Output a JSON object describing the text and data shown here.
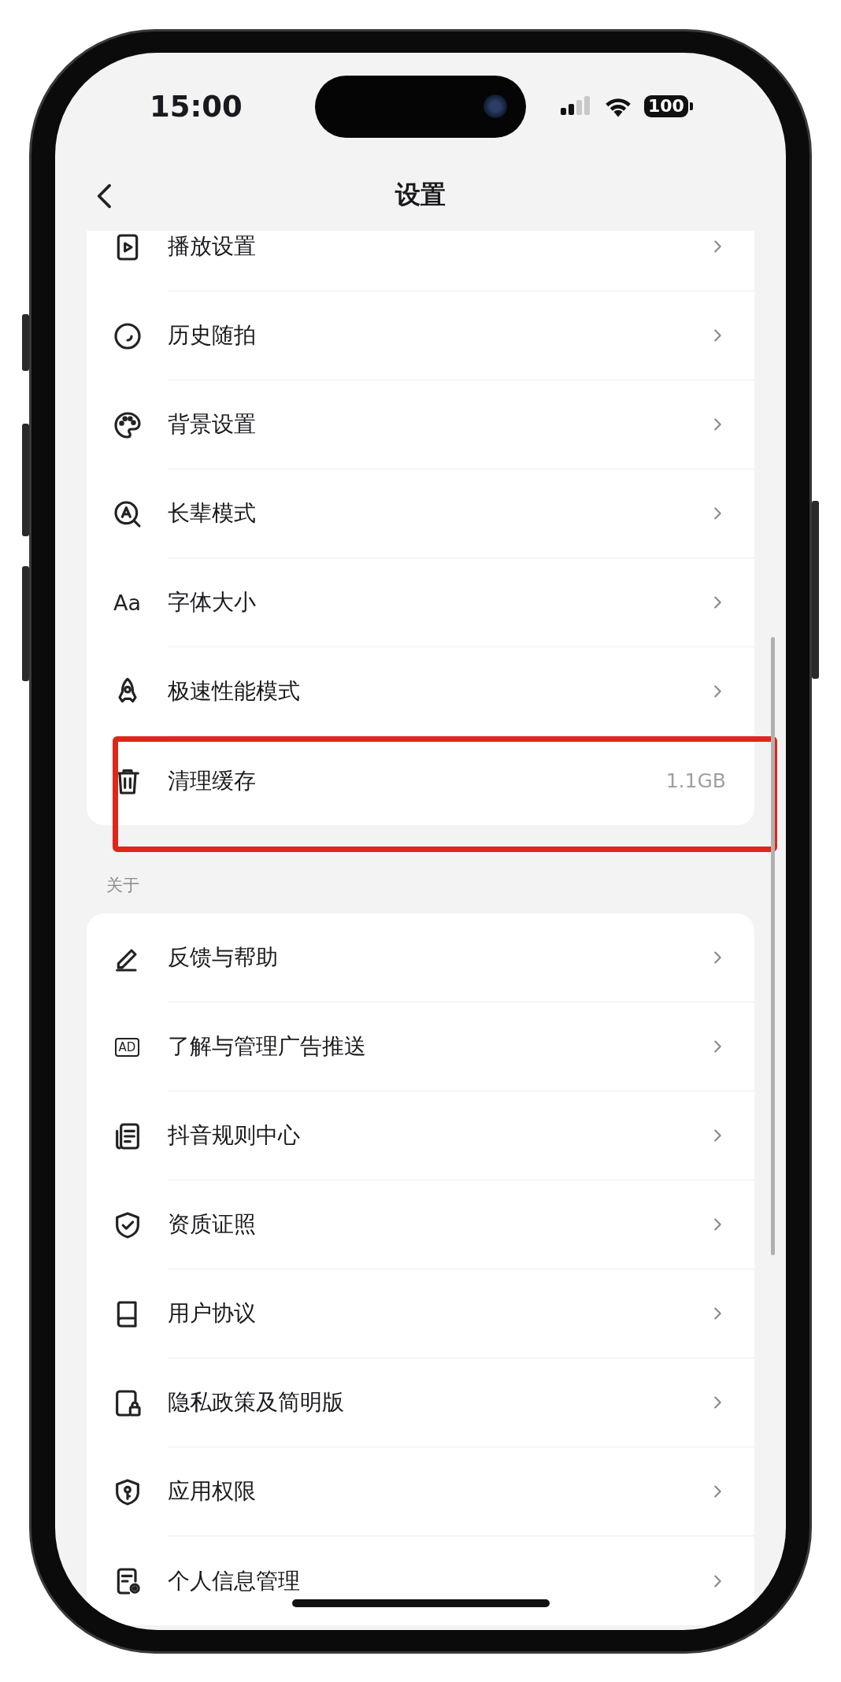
{
  "status_bar": {
    "time": "15:00",
    "battery": "100"
  },
  "nav": {
    "title": "设置"
  },
  "sections": [
    {
      "items": [
        {
          "label": "播放设置",
          "highlighted": false
        },
        {
          "label": "历史随拍",
          "highlighted": false
        },
        {
          "label": "背景设置",
          "highlighted": false
        },
        {
          "label": "长辈模式",
          "highlighted": false
        },
        {
          "label": "字体大小",
          "icon_text": "Aa",
          "highlighted": false
        },
        {
          "label": "极速性能模式",
          "highlighted": false
        },
        {
          "label": "清理缓存",
          "value": "1.1GB",
          "highlighted": true
        }
      ]
    },
    {
      "header": "关于",
      "items": [
        {
          "label": "反馈与帮助",
          "highlighted": false
        },
        {
          "label": "了解与管理广告推送",
          "icon_text": "AD",
          "highlighted": false
        },
        {
          "label": "抖音规则中心",
          "highlighted": false
        },
        {
          "label": "资质证照",
          "highlighted": false
        },
        {
          "label": "用户协议",
          "highlighted": false
        },
        {
          "label": "隐私政策及简明版",
          "highlighted": false
        },
        {
          "label": "应用权限",
          "highlighted": false
        },
        {
          "label": "个人信息管理",
          "highlighted": false
        }
      ]
    }
  ]
}
